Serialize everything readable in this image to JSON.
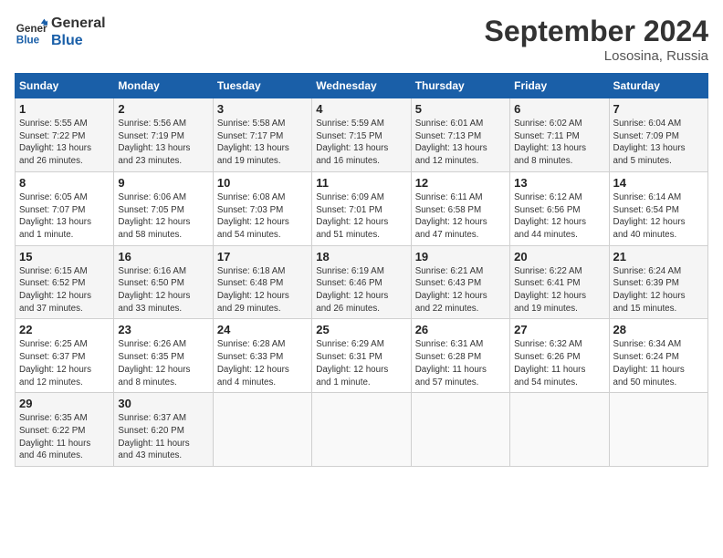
{
  "header": {
    "logo_general": "General",
    "logo_blue": "Blue",
    "month_title": "September 2024",
    "location": "Lososina, Russia"
  },
  "days_of_week": [
    "Sunday",
    "Monday",
    "Tuesday",
    "Wednesday",
    "Thursday",
    "Friday",
    "Saturday"
  ],
  "weeks": [
    [
      {
        "day": 1,
        "info": "Sunrise: 5:55 AM\nSunset: 7:22 PM\nDaylight: 13 hours\nand 26 minutes."
      },
      {
        "day": 2,
        "info": "Sunrise: 5:56 AM\nSunset: 7:19 PM\nDaylight: 13 hours\nand 23 minutes."
      },
      {
        "day": 3,
        "info": "Sunrise: 5:58 AM\nSunset: 7:17 PM\nDaylight: 13 hours\nand 19 minutes."
      },
      {
        "day": 4,
        "info": "Sunrise: 5:59 AM\nSunset: 7:15 PM\nDaylight: 13 hours\nand 16 minutes."
      },
      {
        "day": 5,
        "info": "Sunrise: 6:01 AM\nSunset: 7:13 PM\nDaylight: 13 hours\nand 12 minutes."
      },
      {
        "day": 6,
        "info": "Sunrise: 6:02 AM\nSunset: 7:11 PM\nDaylight: 13 hours\nand 8 minutes."
      },
      {
        "day": 7,
        "info": "Sunrise: 6:04 AM\nSunset: 7:09 PM\nDaylight: 13 hours\nand 5 minutes."
      }
    ],
    [
      {
        "day": 8,
        "info": "Sunrise: 6:05 AM\nSunset: 7:07 PM\nDaylight: 13 hours\nand 1 minute."
      },
      {
        "day": 9,
        "info": "Sunrise: 6:06 AM\nSunset: 7:05 PM\nDaylight: 12 hours\nand 58 minutes."
      },
      {
        "day": 10,
        "info": "Sunrise: 6:08 AM\nSunset: 7:03 PM\nDaylight: 12 hours\nand 54 minutes."
      },
      {
        "day": 11,
        "info": "Sunrise: 6:09 AM\nSunset: 7:01 PM\nDaylight: 12 hours\nand 51 minutes."
      },
      {
        "day": 12,
        "info": "Sunrise: 6:11 AM\nSunset: 6:58 PM\nDaylight: 12 hours\nand 47 minutes."
      },
      {
        "day": 13,
        "info": "Sunrise: 6:12 AM\nSunset: 6:56 PM\nDaylight: 12 hours\nand 44 minutes."
      },
      {
        "day": 14,
        "info": "Sunrise: 6:14 AM\nSunset: 6:54 PM\nDaylight: 12 hours\nand 40 minutes."
      }
    ],
    [
      {
        "day": 15,
        "info": "Sunrise: 6:15 AM\nSunset: 6:52 PM\nDaylight: 12 hours\nand 37 minutes."
      },
      {
        "day": 16,
        "info": "Sunrise: 6:16 AM\nSunset: 6:50 PM\nDaylight: 12 hours\nand 33 minutes."
      },
      {
        "day": 17,
        "info": "Sunrise: 6:18 AM\nSunset: 6:48 PM\nDaylight: 12 hours\nand 29 minutes."
      },
      {
        "day": 18,
        "info": "Sunrise: 6:19 AM\nSunset: 6:46 PM\nDaylight: 12 hours\nand 26 minutes."
      },
      {
        "day": 19,
        "info": "Sunrise: 6:21 AM\nSunset: 6:43 PM\nDaylight: 12 hours\nand 22 minutes."
      },
      {
        "day": 20,
        "info": "Sunrise: 6:22 AM\nSunset: 6:41 PM\nDaylight: 12 hours\nand 19 minutes."
      },
      {
        "day": 21,
        "info": "Sunrise: 6:24 AM\nSunset: 6:39 PM\nDaylight: 12 hours\nand 15 minutes."
      }
    ],
    [
      {
        "day": 22,
        "info": "Sunrise: 6:25 AM\nSunset: 6:37 PM\nDaylight: 12 hours\nand 12 minutes."
      },
      {
        "day": 23,
        "info": "Sunrise: 6:26 AM\nSunset: 6:35 PM\nDaylight: 12 hours\nand 8 minutes."
      },
      {
        "day": 24,
        "info": "Sunrise: 6:28 AM\nSunset: 6:33 PM\nDaylight: 12 hours\nand 4 minutes."
      },
      {
        "day": 25,
        "info": "Sunrise: 6:29 AM\nSunset: 6:31 PM\nDaylight: 12 hours\nand 1 minute."
      },
      {
        "day": 26,
        "info": "Sunrise: 6:31 AM\nSunset: 6:28 PM\nDaylight: 11 hours\nand 57 minutes."
      },
      {
        "day": 27,
        "info": "Sunrise: 6:32 AM\nSunset: 6:26 PM\nDaylight: 11 hours\nand 54 minutes."
      },
      {
        "day": 28,
        "info": "Sunrise: 6:34 AM\nSunset: 6:24 PM\nDaylight: 11 hours\nand 50 minutes."
      }
    ],
    [
      {
        "day": 29,
        "info": "Sunrise: 6:35 AM\nSunset: 6:22 PM\nDaylight: 11 hours\nand 46 minutes."
      },
      {
        "day": 30,
        "info": "Sunrise: 6:37 AM\nSunset: 6:20 PM\nDaylight: 11 hours\nand 43 minutes."
      },
      {
        "day": null,
        "info": ""
      },
      {
        "day": null,
        "info": ""
      },
      {
        "day": null,
        "info": ""
      },
      {
        "day": null,
        "info": ""
      },
      {
        "day": null,
        "info": ""
      }
    ]
  ]
}
